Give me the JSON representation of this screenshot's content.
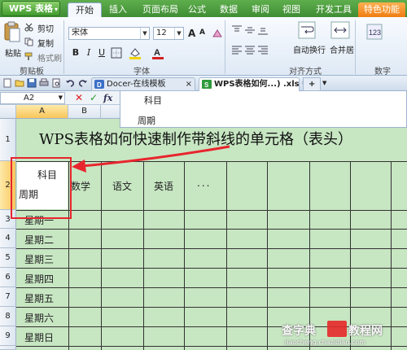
{
  "app": {
    "button_label": "WPS 表格",
    "caret": "▾"
  },
  "ribbon_tabs": [
    "开始",
    "插入",
    "页面布局",
    "公式",
    "数据",
    "审阅",
    "视图",
    "开发工具",
    "特色功能"
  ],
  "clipboard": {
    "paste": "粘贴",
    "cut": "剪切",
    "copy": "复制",
    "format_painter": "格式刷",
    "group_label": "剪贴板"
  },
  "font": {
    "name": "宋体",
    "size": "12",
    "grow": "A",
    "shrink": "A",
    "bold": "B",
    "italic": "I",
    "underline": "U",
    "group_label": "字体",
    "fill_color": "#f2d200",
    "font_color": "#d42020"
  },
  "alignment": {
    "wrap": "自动换行",
    "merge": "合并居",
    "group_label": "对齐方式"
  },
  "number": {
    "group_label": "数字"
  },
  "doc_tabs": {
    "docer": "Docer-在线模板",
    "xls": "WPS表格如何...) .xls *",
    "close": "×",
    "new": "+"
  },
  "formula_bar": {
    "cell_ref": "A2",
    "cancel": "✕",
    "confirm": "✓",
    "fx": "fx",
    "line1": "科目",
    "line2": "周期"
  },
  "columns": [
    "A",
    "B"
  ],
  "rows": [
    "1",
    "2",
    "3",
    "4",
    "5",
    "6",
    "7",
    "8",
    "9"
  ],
  "sheet": {
    "title": "WPS表格如何快速制作带斜线的单元格（表头）",
    "a2_top": "科目",
    "a2_bottom": "周期",
    "header_row": [
      "数学",
      "语文",
      "英语",
      "..."
    ],
    "days": [
      "星期一",
      "星期二",
      "星期三",
      "星期四",
      "星期五",
      "星期六",
      "星期日"
    ]
  },
  "watermark": {
    "brand": "查字典",
    "tutorial": "教程网",
    "url": "jiaocheng.chazidian.com"
  },
  "colors": {
    "sheet_bg": "#c7e6c2",
    "ribbon_green": "#3f8d34",
    "highlight_red": "#e8252d",
    "special_tab": "#ef7d12"
  }
}
